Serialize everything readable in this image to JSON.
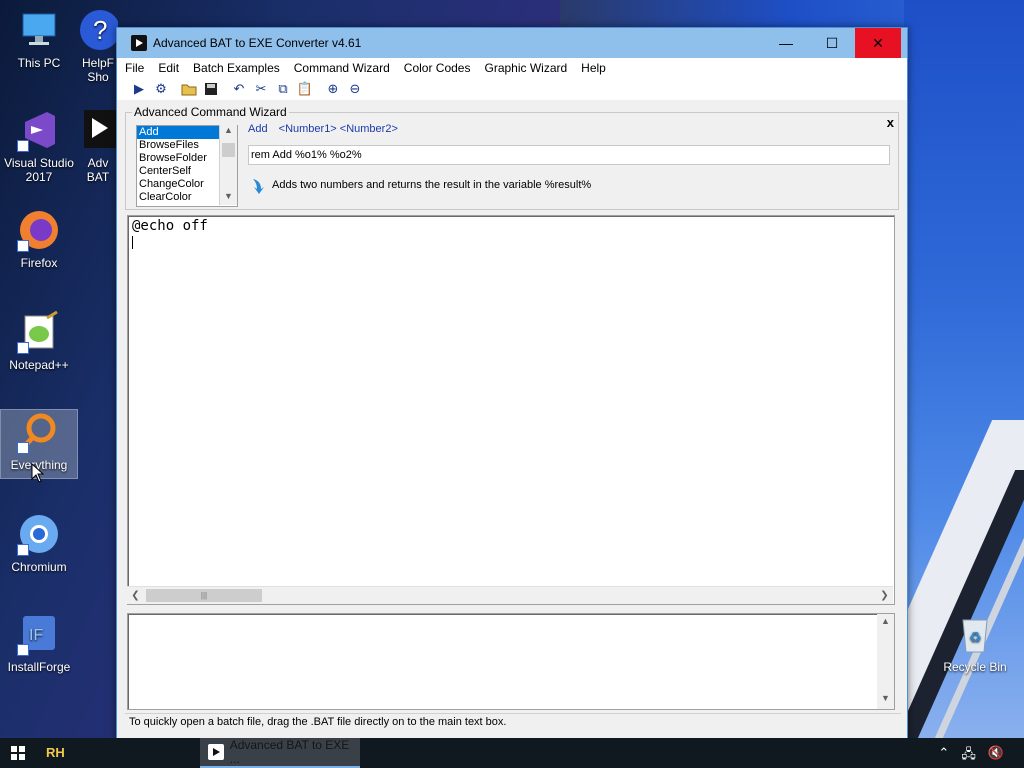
{
  "desktop": {
    "icons": [
      {
        "label": "This PC",
        "icon": "this-pc-icon"
      },
      {
        "label": "HelpF Sho",
        "icon": "help-icon"
      },
      {
        "label": "Visual Studio 2017",
        "icon": "visual-studio-icon"
      },
      {
        "label": "Adv BAT",
        "icon": "adv-bat-icon"
      },
      {
        "label": "Firefox",
        "icon": "firefox-icon"
      },
      {
        "label": "Notepad++",
        "icon": "notepadpp-icon"
      },
      {
        "label": "Everything",
        "icon": "everything-icon"
      },
      {
        "label": "Chromium",
        "icon": "chromium-icon"
      },
      {
        "label": "InstallForge",
        "icon": "installforge-icon"
      },
      {
        "label": "Recycle Bin",
        "icon": "recycle-bin-icon"
      }
    ]
  },
  "window": {
    "title": "Advanced BAT to EXE Converter v4.61",
    "controls": {
      "minimize": "—",
      "maximize": "☐",
      "close": "✕"
    }
  },
  "menu": [
    "File",
    "Edit",
    "Batch Examples",
    "Command Wizard",
    "Color Codes",
    "Graphic Wizard",
    "Help"
  ],
  "wizard": {
    "legend": "Advanced Command Wizard",
    "close": "x",
    "commands": [
      "Add",
      "BrowseFiles",
      "BrowseFolder",
      "CenterSelf",
      "ChangeColor",
      "ClearColor"
    ],
    "selected_command": "Add",
    "syntax_cmd": "Add",
    "syntax_args": "<Number1> <Number2>",
    "input_value": "rem Add %o1% %o2%",
    "description": "Adds two numbers and returns the result in the variable %result%"
  },
  "editor": {
    "content": "@echo off"
  },
  "status": "To quickly open a batch file, drag the .BAT file directly on to the main text box.",
  "taskbar": {
    "rh": "RH",
    "app_label": "Advanced BAT to EXE ..."
  },
  "colors": {
    "titlebar": "#8fc0ec",
    "close_button": "#e81123",
    "selection": "#0078d7"
  }
}
